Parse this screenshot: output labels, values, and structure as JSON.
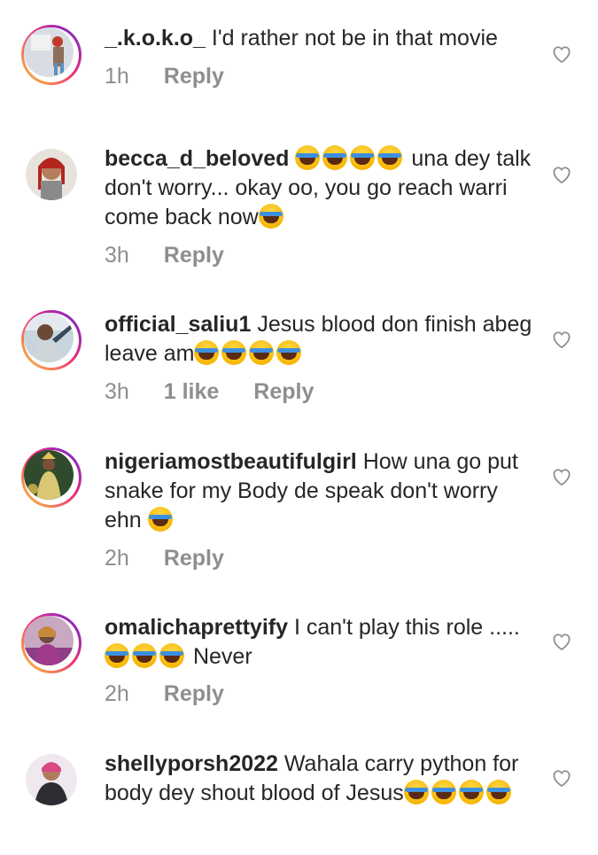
{
  "comments": [
    {
      "username": "_.k.o.k.o_",
      "text_before": "I'd rather not be in that movie",
      "emoji_count": 0,
      "text_after": "",
      "time": "1h",
      "likes": "",
      "reply_label": "Reply",
      "avatar_ring": "gradient"
    },
    {
      "username": "becca_d_beloved",
      "text_before": "",
      "emoji_count": 4,
      "text_after": " una dey talk don't worry... okay oo, you go reach warri come back now",
      "trailing_emoji_count": 1,
      "time": "3h",
      "likes": "",
      "reply_label": "Reply",
      "avatar_ring": "none"
    },
    {
      "username": "official_saliu1",
      "text_before": "Jesus blood don finish abeg leave am",
      "emoji_count": 4,
      "text_after": "",
      "time": "3h",
      "likes": "1 like",
      "reply_label": "Reply",
      "avatar_ring": "gradient"
    },
    {
      "username": "nigeriamostbeautifulgirl",
      "text_before": "How una go put snake for my Body de speak don't worry ehn",
      "emoji_count": 1,
      "text_after": "",
      "time": "2h",
      "likes": "",
      "reply_label": "Reply",
      "avatar_ring": "gradient"
    },
    {
      "username": "omalichaprettyify",
      "text_before": "I can't play this role .....",
      "emoji_count": 3,
      "text_after": "Never",
      "time": "2h",
      "likes": "",
      "reply_label": "Reply",
      "avatar_ring": "gradient"
    },
    {
      "username": "shellyporsh2022",
      "text_before": "Wahala carry python for body dey shout blood of Jesus",
      "emoji_count": 4,
      "text_after": "",
      "time": "",
      "likes": "",
      "reply_label": "",
      "avatar_ring": "none"
    }
  ],
  "icons": {
    "like": "heart-outline-icon",
    "emoji": "face-with-tears-of-joy"
  },
  "colors": {
    "text": "#262626",
    "meta": "#8e8e8e",
    "ring_start": "#f9ce34",
    "ring_mid": "#ee2a7b",
    "ring_end": "#6228d7"
  }
}
